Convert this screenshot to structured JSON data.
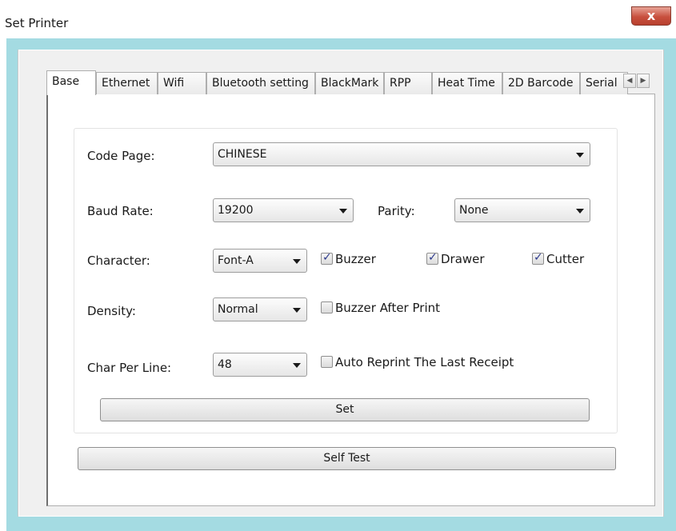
{
  "window": {
    "title": "Set Printer",
    "close_glyph": "x"
  },
  "tabs": [
    {
      "label": "Base",
      "active": true
    },
    {
      "label": "Ethernet",
      "active": false
    },
    {
      "label": "Wifi",
      "active": false
    },
    {
      "label": "Bluetooth setting",
      "active": false
    },
    {
      "label": "BlackMark",
      "active": false
    },
    {
      "label": "RPP",
      "active": false
    },
    {
      "label": "Heat Time",
      "active": false
    },
    {
      "label": "2D Barcode",
      "active": false
    },
    {
      "label": "Serial",
      "active": false
    }
  ],
  "tab_scroll": {
    "left_icon": "chevron-left-icon",
    "right_icon": "chevron-right-icon"
  },
  "base": {
    "code_page": {
      "label": "Code Page:",
      "value": "CHINESE"
    },
    "baud_rate": {
      "label": "Baud Rate:",
      "value": "19200"
    },
    "parity": {
      "label": "Parity:",
      "value": "None"
    },
    "character": {
      "label": "Character:",
      "value": "Font-A"
    },
    "density": {
      "label": "Density:",
      "value": "Normal"
    },
    "char_per_line": {
      "label": "Char Per Line:",
      "value": "48"
    },
    "buzzer": {
      "label": "Buzzer",
      "checked": true
    },
    "drawer": {
      "label": "Drawer",
      "checked": true
    },
    "cutter": {
      "label": "Cutter",
      "checked": true
    },
    "buzzer_after_print": {
      "label": "Buzzer After Print",
      "checked": false
    },
    "auto_reprint": {
      "label": "Auto Reprint The Last Receipt",
      "checked": false
    },
    "set_button": "Set"
  },
  "self_test_button": "Self Test",
  "colors": {
    "frame": "#a4dbe2",
    "close_button": "#c8503e",
    "checkmark": "#2d3a8c"
  }
}
